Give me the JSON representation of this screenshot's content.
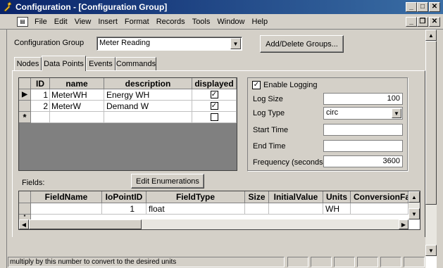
{
  "window": {
    "title": "Configuration - [Configuration Group]"
  },
  "menu": [
    "File",
    "Edit",
    "View",
    "Insert",
    "Format",
    "Records",
    "Tools",
    "Window",
    "Help"
  ],
  "header": {
    "group_label": "Configuration Group",
    "group_value": "Meter Reading",
    "add_delete_label": "Add/Delete Groups..."
  },
  "tabs": [
    {
      "label": "Nodes",
      "active": false
    },
    {
      "label": "Data Points",
      "active": true
    },
    {
      "label": "Events",
      "active": false
    },
    {
      "label": "Commands",
      "active": false
    }
  ],
  "points_table": {
    "columns": [
      "ID",
      "name",
      "description",
      "displayed"
    ],
    "rows": [
      {
        "id": "1",
        "name": "MeterWH",
        "description": "Energy WH",
        "displayed": true
      },
      {
        "id": "2",
        "name": "MeterW",
        "description": "Demand W",
        "displayed": true
      }
    ],
    "new_row_marker": "*",
    "current_row_marker": "▶"
  },
  "logging": {
    "enable_label": "Enable Logging",
    "enabled": true,
    "log_size_label": "Log Size",
    "log_size_value": "100",
    "log_type_label": "Log Type",
    "log_type_value": "circ",
    "start_time_label": "Start Time",
    "start_time_value": "",
    "end_time_label": "End Time",
    "end_time_value": "",
    "frequency_label": "Frequency (seconds)",
    "frequency_value": "3600"
  },
  "fields": {
    "label": "Fields:",
    "edit_enum_label": "Edit Enumerations",
    "columns": [
      "FieldName",
      "IoPointID",
      "FieldType",
      "Size",
      "InitialValue",
      "Units",
      "ConversionFactor"
    ],
    "row": {
      "fieldname": "",
      "iopointid": "1",
      "fieldtype": "float",
      "size": "",
      "initialvalue": "",
      "units": "WH",
      "conversionfactor": ""
    }
  },
  "status": {
    "text": "multiply by this number to convert to the desired units"
  },
  "colors": {
    "title_start": "#0a246a",
    "title_end": "#3a6ea5",
    "face": "#d4d0c8"
  }
}
